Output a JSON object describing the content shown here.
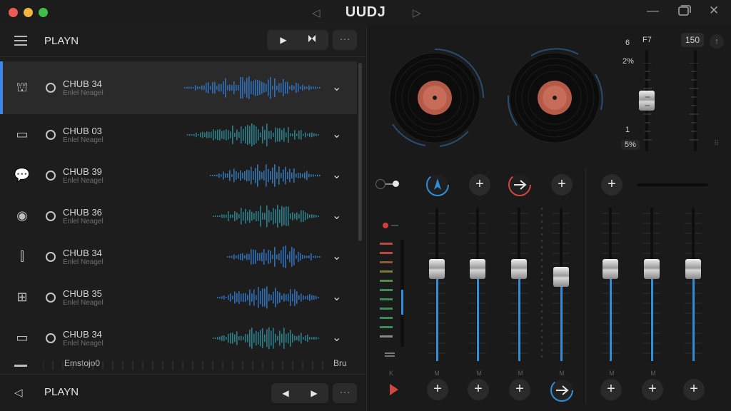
{
  "window": {
    "title": "UUDJ"
  },
  "playlist": {
    "header_title": "PLAYN",
    "footer_title": "PLAYN",
    "rows": [
      {
        "title": "CHUB 34",
        "subtitle": "Enlel Neagel",
        "icon": "gift-icon",
        "selected": true
      },
      {
        "title": "CHUB 03",
        "subtitle": "Enlel Neagel",
        "icon": "crate-icon",
        "selected": false
      },
      {
        "title": "CHUB 39",
        "subtitle": "Enlel Neagel",
        "icon": "chat-icon",
        "selected": false
      },
      {
        "title": "CHUB 36",
        "subtitle": "Enlel Neagel",
        "icon": "disc-icon",
        "selected": false
      },
      {
        "title": "CHUB 34",
        "subtitle": "Enlel Neagel",
        "icon": "equalizer-icon",
        "selected": false
      },
      {
        "title": "CHUB 35",
        "subtitle": "Enlel Neagel",
        "icon": "sliders-icon",
        "selected": false
      },
      {
        "title": "CHUB 34",
        "subtitle": "Enlel Neagel",
        "icon": "window-icon",
        "selected": false
      }
    ],
    "overflow_label": "Emstojo0",
    "overflow_right": "Bru"
  },
  "mixer": {
    "top_left_label": "6",
    "top_f_label": "F7",
    "top_bpm_label": "150",
    "pitch_top": "2%",
    "pitch_mid": "1",
    "pitch_bottom": "5%",
    "channel_labels": [
      "K",
      "M",
      "M",
      "M",
      "M",
      "M",
      "M"
    ],
    "accent": "#2f8fd8",
    "channel_levels": [
      0.6,
      0.6,
      0.6,
      0.55,
      0.6,
      0.6,
      0.6
    ]
  }
}
